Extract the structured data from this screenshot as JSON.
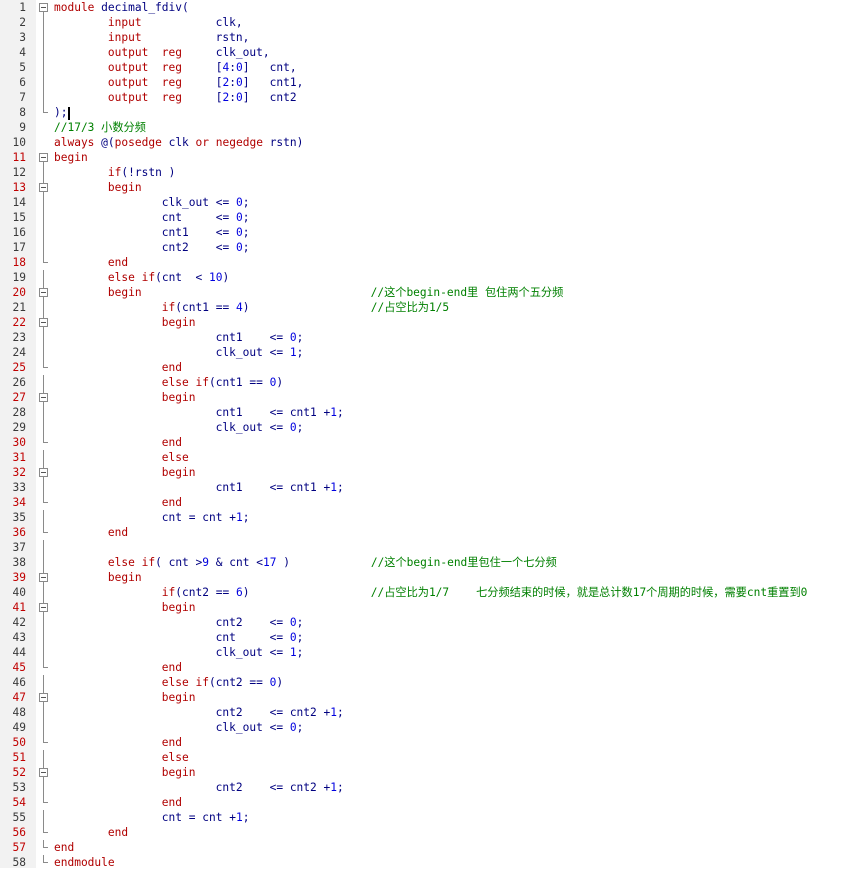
{
  "editor": {
    "language": "verilog",
    "lines": [
      {
        "n": "1",
        "code": "module decimal_fdiv(",
        "red": false,
        "fold": "box"
      },
      {
        "n": "2",
        "code": "        input           clk,",
        "red": false,
        "fold": "line"
      },
      {
        "n": "3",
        "code": "        input           rstn,",
        "red": false,
        "fold": "line"
      },
      {
        "n": "4",
        "code": "        output  reg     clk_out,",
        "red": false,
        "fold": "line"
      },
      {
        "n": "5",
        "code": "        output  reg     [4:0]   cnt,",
        "red": false,
        "fold": "line"
      },
      {
        "n": "6",
        "code": "        output  reg     [2:0]   cnt1,",
        "red": false,
        "fold": "line"
      },
      {
        "n": "7",
        "code": "        output  reg     [2:0]   cnt2",
        "red": false,
        "fold": "line"
      },
      {
        "n": "8",
        "code": ");",
        "red": false,
        "fold": "end",
        "cursor": true
      },
      {
        "n": "9",
        "code": "//17/3 小数分频",
        "red": false,
        "fold": "none"
      },
      {
        "n": "10",
        "code": "always @(posedge clk or negedge rstn)",
        "red": false,
        "fold": "none"
      },
      {
        "n": "11",
        "code": "begin",
        "red": true,
        "fold": "box"
      },
      {
        "n": "12",
        "code": "        if(!rstn )",
        "red": false,
        "fold": "line"
      },
      {
        "n": "13",
        "code": "        begin",
        "red": true,
        "fold": "box"
      },
      {
        "n": "14",
        "code": "                clk_out <= 0;",
        "red": false,
        "fold": "line"
      },
      {
        "n": "15",
        "code": "                cnt     <= 0;",
        "red": false,
        "fold": "line"
      },
      {
        "n": "16",
        "code": "                cnt1    <= 0;",
        "red": false,
        "fold": "line"
      },
      {
        "n": "17",
        "code": "                cnt2    <= 0;",
        "red": false,
        "fold": "line"
      },
      {
        "n": "18",
        "code": "        end",
        "red": true,
        "fold": "end"
      },
      {
        "n": "19",
        "code": "        else if(cnt  < 10)",
        "red": false,
        "fold": "line"
      },
      {
        "n": "20",
        "code": "        begin                                  //这个begin-end里 包住两个五分频",
        "red": true,
        "fold": "box"
      },
      {
        "n": "21",
        "code": "                if(cnt1 == 4)                  //占空比为1/5",
        "red": false,
        "fold": "line"
      },
      {
        "n": "22",
        "code": "                begin",
        "red": true,
        "fold": "box"
      },
      {
        "n": "23",
        "code": "                        cnt1    <= 0;",
        "red": false,
        "fold": "line"
      },
      {
        "n": "24",
        "code": "                        clk_out <= 1;",
        "red": false,
        "fold": "line"
      },
      {
        "n": "25",
        "code": "                end",
        "red": true,
        "fold": "end"
      },
      {
        "n": "26",
        "code": "                else if(cnt1 == 0)",
        "red": false,
        "fold": "line"
      },
      {
        "n": "27",
        "code": "                begin",
        "red": true,
        "fold": "box"
      },
      {
        "n": "28",
        "code": "                        cnt1    <= cnt1 +1;",
        "red": false,
        "fold": "line"
      },
      {
        "n": "29",
        "code": "                        clk_out <= 0;",
        "red": false,
        "fold": "line"
      },
      {
        "n": "30",
        "code": "                end",
        "red": true,
        "fold": "end"
      },
      {
        "n": "31",
        "code": "                else",
        "red": true,
        "fold": "line"
      },
      {
        "n": "32",
        "code": "                begin",
        "red": true,
        "fold": "box"
      },
      {
        "n": "33",
        "code": "                        cnt1    <= cnt1 +1;",
        "red": false,
        "fold": "line"
      },
      {
        "n": "34",
        "code": "                end",
        "red": true,
        "fold": "end"
      },
      {
        "n": "35",
        "code": "                cnt = cnt +1;",
        "red": false,
        "fold": "line"
      },
      {
        "n": "36",
        "code": "        end",
        "red": true,
        "fold": "end"
      },
      {
        "n": "37",
        "code": "",
        "red": false,
        "fold": "line"
      },
      {
        "n": "38",
        "code": "        else if( cnt >9 & cnt <17 )            //这个begin-end里包住一个七分频",
        "red": false,
        "fold": "line"
      },
      {
        "n": "39",
        "code": "        begin",
        "red": true,
        "fold": "box"
      },
      {
        "n": "40",
        "code": "                if(cnt2 == 6)                  //占空比为1/7    七分频结束的时候，就是总计数17个周期的时候，需要cnt重置到0",
        "red": false,
        "fold": "line"
      },
      {
        "n": "41",
        "code": "                begin",
        "red": true,
        "fold": "box"
      },
      {
        "n": "42",
        "code": "                        cnt2    <= 0;",
        "red": false,
        "fold": "line"
      },
      {
        "n": "43",
        "code": "                        cnt     <= 0;",
        "red": false,
        "fold": "line"
      },
      {
        "n": "44",
        "code": "                        clk_out <= 1;",
        "red": false,
        "fold": "line"
      },
      {
        "n": "45",
        "code": "                end",
        "red": true,
        "fold": "end"
      },
      {
        "n": "46",
        "code": "                else if(cnt2 == 0)",
        "red": false,
        "fold": "line"
      },
      {
        "n": "47",
        "code": "                begin",
        "red": true,
        "fold": "box"
      },
      {
        "n": "48",
        "code": "                        cnt2    <= cnt2 +1;",
        "red": false,
        "fold": "line"
      },
      {
        "n": "49",
        "code": "                        clk_out <= 0;",
        "red": false,
        "fold": "line"
      },
      {
        "n": "50",
        "code": "                end",
        "red": true,
        "fold": "end"
      },
      {
        "n": "51",
        "code": "                else",
        "red": true,
        "fold": "line"
      },
      {
        "n": "52",
        "code": "                begin",
        "red": true,
        "fold": "box"
      },
      {
        "n": "53",
        "code": "                        cnt2    <= cnt2 +1;",
        "red": false,
        "fold": "line"
      },
      {
        "n": "54",
        "code": "                end",
        "red": true,
        "fold": "end"
      },
      {
        "n": "55",
        "code": "                cnt = cnt +1;",
        "red": false,
        "fold": "line"
      },
      {
        "n": "56",
        "code": "        end",
        "red": true,
        "fold": "end"
      },
      {
        "n": "57",
        "code": "end",
        "red": true,
        "fold": "end"
      },
      {
        "n": "58",
        "code": "endmodule",
        "red": false,
        "fold": "end"
      }
    ]
  },
  "colors": {
    "keyword": "#b00000",
    "identifier": "#000080",
    "number": "#0000e0",
    "comment": "#008000",
    "line_number": "#3a3a3a",
    "line_number_block": "#c00000",
    "gutter_bg": "#f2f2f2"
  }
}
